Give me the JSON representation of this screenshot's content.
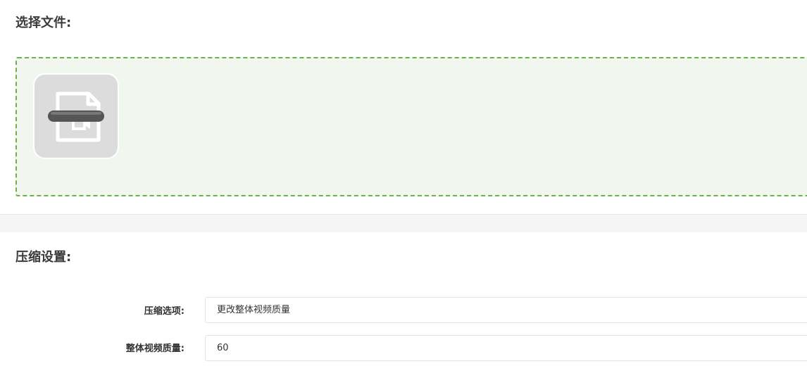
{
  "file_section": {
    "title": "选择文件:",
    "file_icon": "video-file-icon",
    "accent_color": "#6cb24a"
  },
  "settings_section": {
    "title": "压缩设置:",
    "fields": [
      {
        "label": "压缩选项:",
        "value": "更改整体视频质量"
      },
      {
        "label": "整体视频质量:",
        "value": "60"
      }
    ]
  }
}
